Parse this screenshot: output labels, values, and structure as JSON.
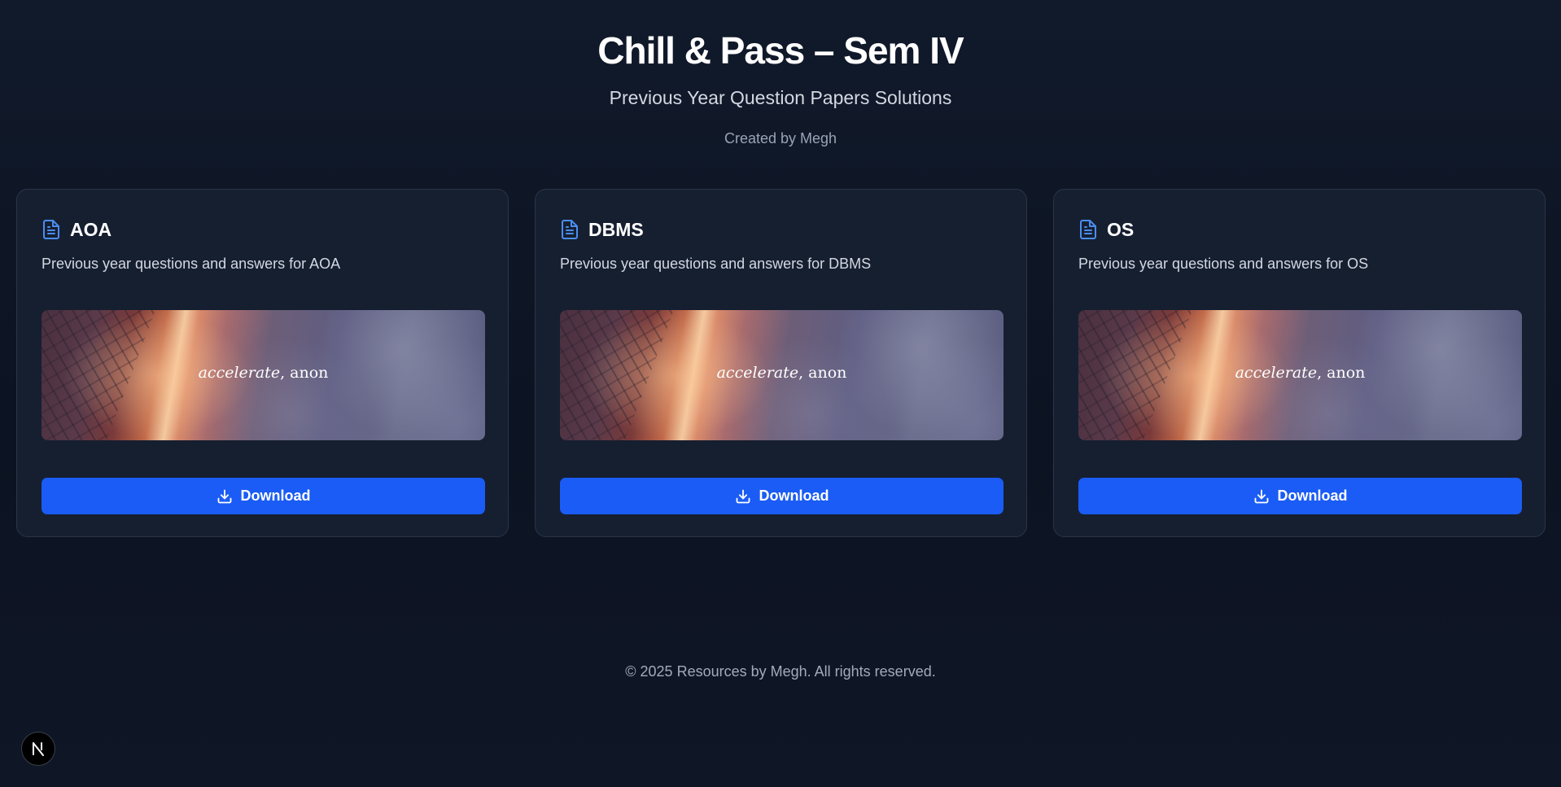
{
  "header": {
    "title": "Chill & Pass – Sem IV",
    "subtitle": "Previous Year Question Papers Solutions",
    "credit": "Created by Megh"
  },
  "cards": [
    {
      "title": "AOA",
      "description": "Previous year questions and answers for AOA",
      "banner_accent": "accelerate",
      "banner_rest": ", anon",
      "button_label": "Download",
      "icon": "document-icon"
    },
    {
      "title": "DBMS",
      "description": "Previous year questions and answers for DBMS",
      "banner_accent": "accelerate",
      "banner_rest": ", anon",
      "button_label": "Download",
      "icon": "document-icon"
    },
    {
      "title": "OS",
      "description": "Previous year questions and answers for OS",
      "banner_accent": "accelerate",
      "banner_rest": ", anon",
      "button_label": "Download",
      "icon": "document-icon"
    }
  ],
  "footer": {
    "text": "© 2025 Resources by Megh. All rights reserved."
  },
  "badge": {
    "letter": "N",
    "icon": "nextjs-logo-icon"
  },
  "colors": {
    "background": "#0c1322",
    "card": "#161f30",
    "accent": "#1a5cf5",
    "icon_blue": "#4a8df0"
  }
}
